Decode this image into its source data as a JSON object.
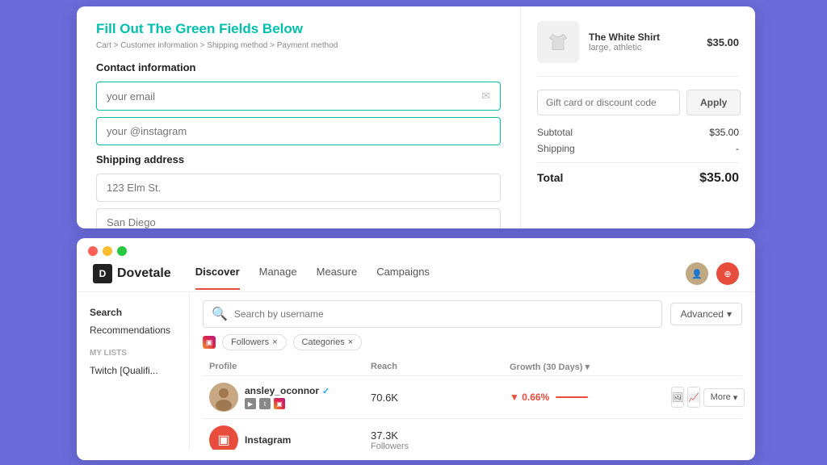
{
  "checkout": {
    "title": "Fill Out The Green Fields Below",
    "breadcrumb": "Cart > Customer information > Shipping method > Payment method",
    "contact_section": "Contact information",
    "email_placeholder": "your email",
    "instagram_placeholder": "your @instagram",
    "shipping_section": "Shipping address",
    "address_placeholder": "123 Elm St.",
    "city_placeholder": "San Diego",
    "product": {
      "name": "The White Shirt",
      "variant": "large, athletic",
      "price": "$35.00"
    },
    "discount_placeholder": "Gift card or discount code",
    "apply_label": "Apply",
    "subtotal_label": "Subtotal",
    "subtotal_value": "$35.00",
    "shipping_label": "Shipping",
    "shipping_value": "-",
    "total_label": "Total",
    "total_value": "$35.00"
  },
  "dovetale": {
    "logo": "Dovetale",
    "nav": {
      "discover": "Discover",
      "manage": "Manage",
      "measure": "Measure",
      "campaigns": "Campaigns"
    },
    "sidebar": {
      "search_label": "Search",
      "recommendations_label": "Recommendations",
      "my_lists_label": "MY LISTS",
      "list_item": "Twitch [Qualifi..."
    },
    "search_placeholder": "Search by username",
    "advanced_label": "Advanced",
    "filters": {
      "followers": "Followers",
      "categories": "Categories"
    },
    "table": {
      "profile_header": "Profile",
      "reach_header": "Reach",
      "growth_header": "Growth (30 Days)",
      "row1": {
        "username": "ansley_oconnor",
        "reach": "70.6K",
        "growth": "0.66%",
        "more": "More"
      },
      "row2": {
        "username": "Instagram",
        "reach": "37.3K",
        "reach_label": "Followers"
      }
    }
  }
}
